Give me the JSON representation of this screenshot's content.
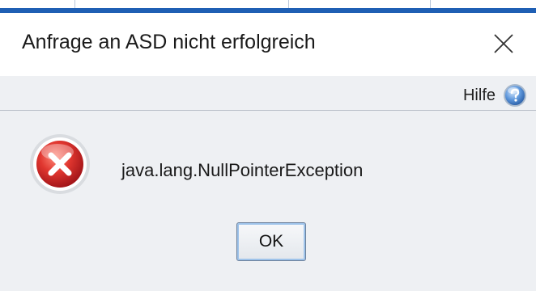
{
  "dialog": {
    "title": "Anfrage an ASD nicht erfolgreich",
    "close_icon": "close-icon"
  },
  "help": {
    "label": "Hilfe",
    "icon": "help-icon"
  },
  "message": {
    "icon": "error-icon",
    "text": "java.lang.NullPointerException"
  },
  "buttons": {
    "ok_label": "OK"
  },
  "colors": {
    "content_bg": "#eef0f3",
    "error_red": "#d42a2a",
    "help_blue": "#3a78c9",
    "button_focus": "#9ec3ea"
  }
}
